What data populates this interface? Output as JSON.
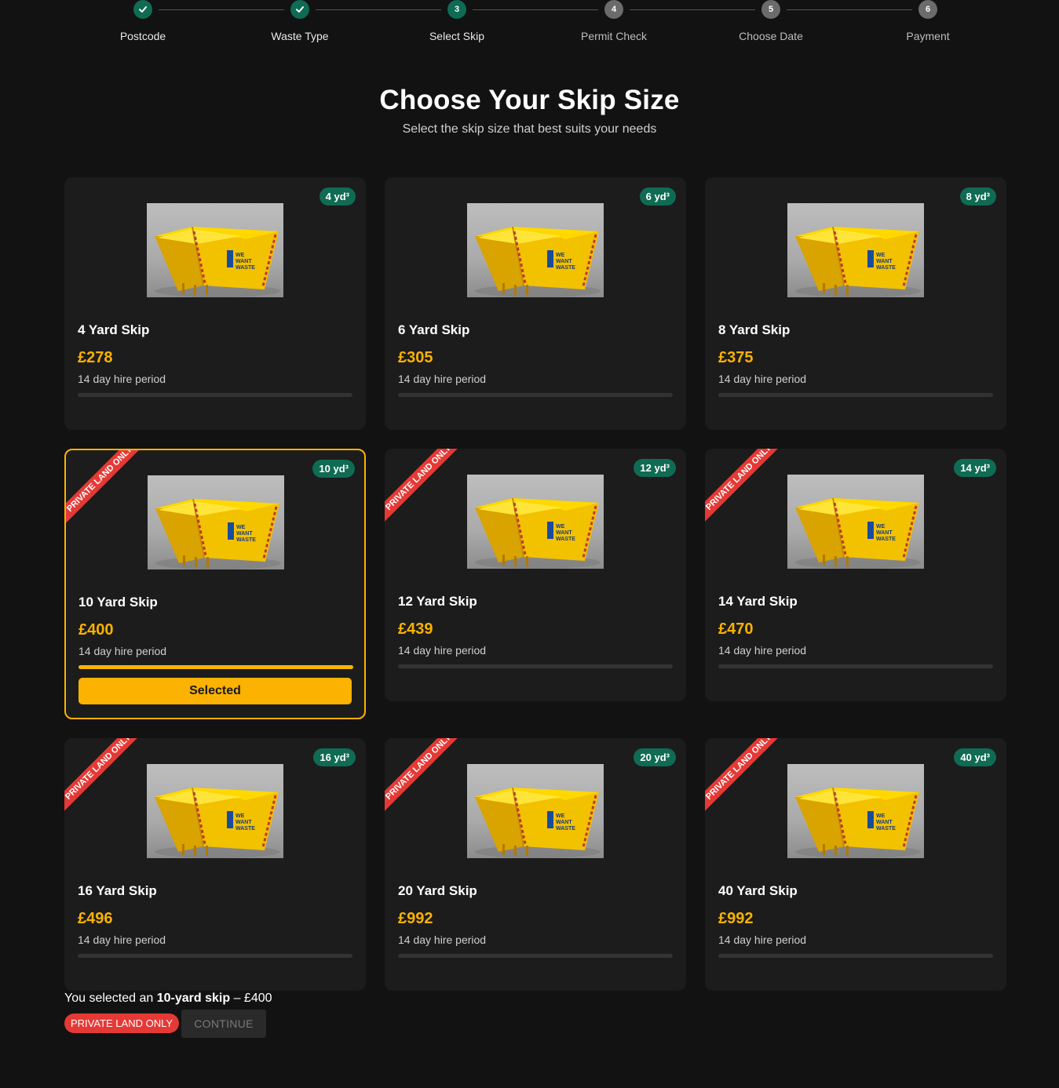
{
  "stepper": {
    "steps": [
      {
        "num": "",
        "label": "Postcode",
        "state": "done"
      },
      {
        "num": "",
        "label": "Waste Type",
        "state": "done"
      },
      {
        "num": "3",
        "label": "Select Skip",
        "state": "current"
      },
      {
        "num": "4",
        "label": "Permit Check",
        "state": "future"
      },
      {
        "num": "5",
        "label": "Choose Date",
        "state": "future"
      },
      {
        "num": "6",
        "label": "Payment",
        "state": "future"
      }
    ]
  },
  "heading": {
    "title": "Choose Your Skip Size",
    "subtitle": "Select the skip size that best suits your needs"
  },
  "cards": [
    {
      "badge": "4 yd³",
      "title": "4 Yard Skip",
      "price": "£278",
      "period": "14 day hire period",
      "private_land": false,
      "selected": false
    },
    {
      "badge": "6 yd³",
      "title": "6 Yard Skip",
      "price": "£305",
      "period": "14 day hire period",
      "private_land": false,
      "selected": false
    },
    {
      "badge": "8 yd³",
      "title": "8 Yard Skip",
      "price": "£375",
      "period": "14 day hire period",
      "private_land": false,
      "selected": false
    },
    {
      "badge": "10 yd³",
      "title": "10 Yard Skip",
      "price": "£400",
      "period": "14 day hire period",
      "private_land": true,
      "selected": true,
      "ribbon": "PRIVATE LAND ONLY",
      "button": "Selected"
    },
    {
      "badge": "12 yd³",
      "title": "12 Yard Skip",
      "price": "£439",
      "period": "14 day hire period",
      "private_land": true,
      "selected": false,
      "ribbon": "PRIVATE LAND ONLY"
    },
    {
      "badge": "14 yd³",
      "title": "14 Yard Skip",
      "price": "£470",
      "period": "14 day hire period",
      "private_land": true,
      "selected": false,
      "ribbon": "PRIVATE LAND ONLY"
    },
    {
      "badge": "16 yd³",
      "title": "16 Yard Skip",
      "price": "£496",
      "period": "14 day hire period",
      "private_land": true,
      "selected": false,
      "ribbon": "PRIVATE LAND ONLY"
    },
    {
      "badge": "20 yd³",
      "title": "20 Yard Skip",
      "price": "£992",
      "period": "14 day hire period",
      "private_land": true,
      "selected": false,
      "ribbon": "PRIVATE LAND ONLY"
    },
    {
      "badge": "40 yd³",
      "title": "40 Yard Skip",
      "price": "£992",
      "period": "14 day hire period",
      "private_land": true,
      "selected": false,
      "ribbon": "PRIVATE LAND ONLY"
    }
  ],
  "summary": {
    "prefix": "You selected an ",
    "size": "10-yard skip",
    "suffix": " – £400",
    "pill": "PRIVATE LAND ONLY",
    "continue_label": "CONTINUE"
  },
  "colors": {
    "background": "#121212",
    "card": "#1c1c1c",
    "accent": "#fbb200",
    "badge": "#0f6b54",
    "ribbon": "#e53935"
  },
  "icons": {
    "done_step": "check-icon",
    "skip_image": "yellow-skip-image"
  }
}
